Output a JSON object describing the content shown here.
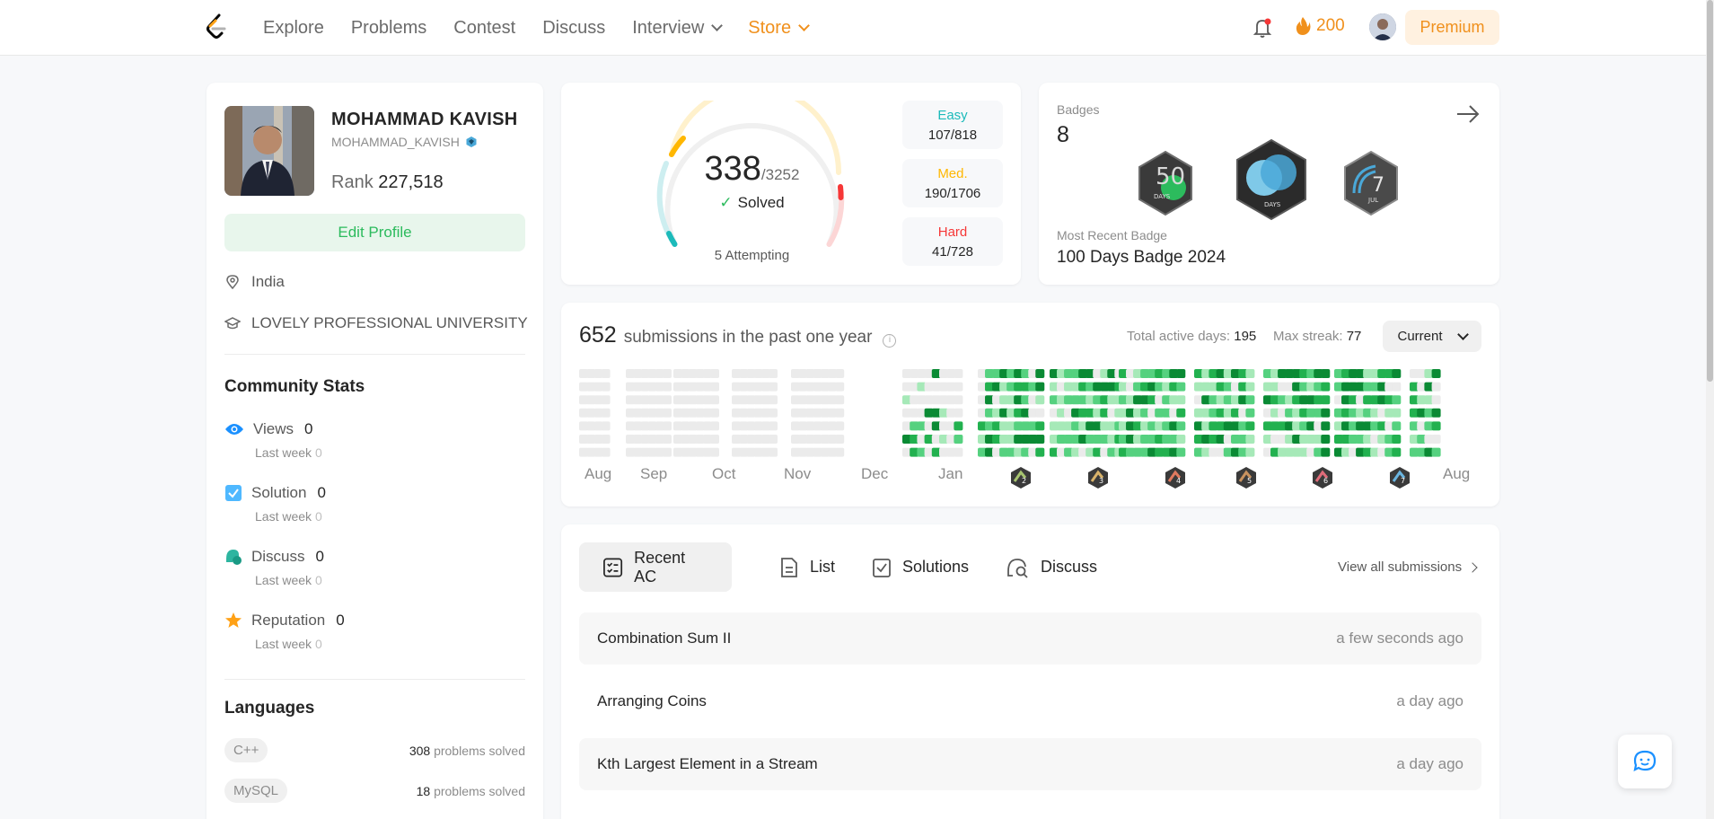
{
  "nav": {
    "links": [
      "Explore",
      "Problems",
      "Contest",
      "Discuss",
      "Interview",
      "Store"
    ],
    "streak": "200",
    "premium": "Premium"
  },
  "profile": {
    "name": "MOHAMMAD KAVISH",
    "handle": "MOHAMMAD_KAVISH",
    "rank_label": "Rank",
    "rank_value": "227,518",
    "edit_label": "Edit Profile",
    "location": "India",
    "school": "LOVELY PROFESSIONAL UNIVERSITY"
  },
  "community": {
    "title": "Community Stats",
    "stats": [
      {
        "label": "Views",
        "value": "0",
        "sub_label": "Last week",
        "sub_value": "0",
        "icon": "eye-icon"
      },
      {
        "label": "Solution",
        "value": "0",
        "sub_label": "Last week",
        "sub_value": "0",
        "icon": "solution-icon"
      },
      {
        "label": "Discuss",
        "value": "0",
        "sub_label": "Last week",
        "sub_value": "0",
        "icon": "discuss-icon"
      },
      {
        "label": "Reputation",
        "value": "0",
        "sub_label": "Last week",
        "sub_value": "0",
        "icon": "star-icon"
      }
    ]
  },
  "languages": {
    "title": "Languages",
    "items": [
      {
        "name": "C++",
        "count": "308",
        "suffix": "problems solved"
      },
      {
        "name": "MySQL",
        "count": "18",
        "suffix": "problems solved"
      }
    ]
  },
  "solved": {
    "count": "338",
    "total": "/3252",
    "label": "Solved",
    "attempting": "5 Attempting",
    "difficulties": [
      {
        "label": "Easy",
        "value": "107/818",
        "color": "#1cbaba",
        "solved": 107,
        "total": 818
      },
      {
        "label": "Med.",
        "value": "190/1706",
        "color": "#ffb700",
        "solved": 190,
        "total": 1706
      },
      {
        "label": "Hard",
        "value": "41/728",
        "color": "#f63737",
        "solved": 41,
        "total": 728
      }
    ]
  },
  "badges": {
    "label": "Badges",
    "count": "8",
    "recent_label": "Most Recent Badge",
    "recent_value": "100 Days Badge 2024",
    "items": [
      {
        "text": "DAYS",
        "num": "50",
        "color": "#2f2f2f"
      },
      {
        "text": "DAYS",
        "num": "",
        "color": "#2f2f2f"
      },
      {
        "text": "JUL",
        "num": "7",
        "color": "#5a5a5a"
      }
    ]
  },
  "heatmap": {
    "count": "652",
    "text": "submissions in the past one year",
    "active_label": "Total active days:",
    "active_value": "195",
    "streak_label": "Max streak:",
    "streak_value": "77",
    "dropdown": "Current",
    "months": [
      "Aug",
      "Sep",
      "Oct",
      "Nov",
      "Dec",
      "Jan",
      "Aug"
    ],
    "month_badges": [
      "2",
      "3",
      "4",
      "5",
      "6",
      "7"
    ],
    "colors": {
      "empty": "#ebebeb",
      "l1": "#a6e9b8",
      "l2": "#55d17f",
      "l3": "#22b14f",
      "l4": "#0a8a34"
    }
  },
  "submissions": {
    "tabs": [
      "Recent AC",
      "List",
      "Solutions",
      "Discuss"
    ],
    "view_all": "View all submissions",
    "rows": [
      {
        "title": "Combination Sum II",
        "time": "a few seconds ago"
      },
      {
        "title": "Arranging Coins",
        "time": "a day ago"
      },
      {
        "title": "Kth Largest Element in a Stream",
        "time": "a day ago"
      }
    ]
  }
}
